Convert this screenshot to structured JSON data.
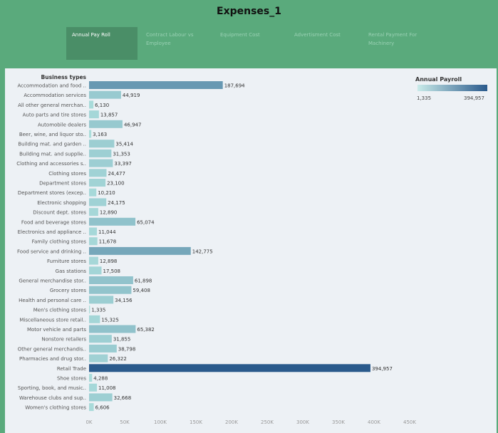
{
  "title": "Expenses_1",
  "tabs": [
    {
      "label": "Annual Pay Roll",
      "active": true
    },
    {
      "label": "Contract Labour vs Employee",
      "active": false
    },
    {
      "label": "Equipment Cost",
      "active": false
    },
    {
      "label": "Advertisment Cost",
      "active": false
    },
    {
      "label": "Rental Payment For Machinery",
      "active": false
    }
  ],
  "legend": {
    "title": "Annual Payroll",
    "min_label": "1,335",
    "max_label": "394,957",
    "color_low": "#c9ebe9",
    "color_high": "#2a5a8c"
  },
  "chart_data": {
    "type": "bar",
    "orientation": "horizontal",
    "ylabel": "Business types",
    "xlim": [
      0,
      450000
    ],
    "x_ticks": [
      "0K",
      "50K",
      "100K",
      "150K",
      "200K",
      "250K",
      "300K",
      "350K",
      "400K",
      "450K"
    ],
    "categories": [
      "Accommodation and food ..",
      "Accommodation services",
      "All other general merchan..",
      "Auto parts and tire stores",
      "Automobile dealers",
      "Beer, wine, and liquor sto..",
      "Building mat. and garden ..",
      "Building mat. and supplie..",
      "Clothing and accessories s..",
      "Clothing stores",
      "Department stores",
      "Department stores (excep..",
      "Electronic shopping",
      "Discount dept. stores",
      "Food and beverage stores",
      "Electronics and appliance ..",
      "Family clothing stores",
      "Food service and drinking ..",
      "Furniture stores",
      "Gas stations",
      "General merchandise stor..",
      "Grocery stores",
      "Health and personal care ..",
      "Men's clothing stores",
      "Miscellaneous store retail..",
      "Motor vehicle and parts",
      "Nonstore retailers",
      "Other general merchandis..",
      "Pharmacies and drug stor..",
      "Retail Trade",
      "Shoe stores",
      "Sporting, book, and music..",
      "Warehouse clubs and sup..",
      "Women's clothing stores"
    ],
    "values": [
      187694,
      44919,
      6130,
      13857,
      46947,
      3163,
      35414,
      31353,
      33397,
      24477,
      23100,
      10210,
      24175,
      12890,
      65074,
      11044,
      11678,
      142775,
      12898,
      17508,
      61898,
      59408,
      34156,
      1335,
      15325,
      65382,
      31855,
      38798,
      26322,
      394957,
      4288,
      11008,
      32668,
      6606
    ],
    "data_labels": [
      "187,694",
      "44,919",
      "6,130",
      "13,857",
      "46,947",
      "3,163",
      "35,414",
      "31,353",
      "33,397",
      "24,477",
      "23,100",
      "10,210",
      "24,175",
      "12,890",
      "65,074",
      "11,044",
      "11,678",
      "142,775",
      "12,898",
      "17,508",
      "61,898",
      "59,408",
      "34,156",
      "1,335",
      "15,325",
      "65,382",
      "31,855",
      "38,798",
      "26,322",
      "394,957",
      "4,288",
      "11,008",
      "32,668",
      "6,606"
    ],
    "grid": false,
    "legend_position": "top-right"
  }
}
